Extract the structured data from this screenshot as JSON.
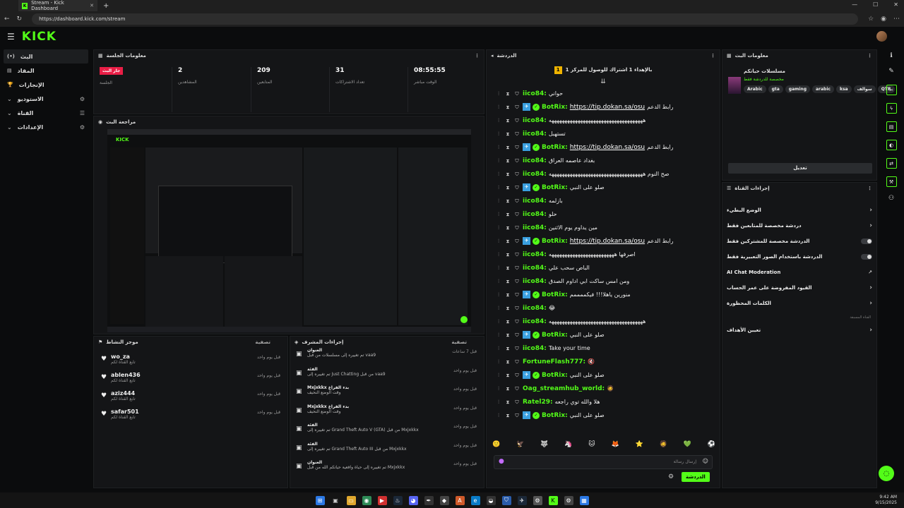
{
  "browser": {
    "tab_title": "Stream - Kick Dashboard",
    "url": "https://dashboard.kick.com/stream"
  },
  "app": {
    "logo": "KICK"
  },
  "sidebar": {
    "items": [
      {
        "label": "البث",
        "icon": "(•)"
      },
      {
        "label": "المقاد",
        "icon": "▤"
      },
      {
        "label": "الإنجازات",
        "icon": "🏆"
      },
      {
        "label": "الاستوديو",
        "icon": "⚙"
      },
      {
        "label": "القناة",
        "icon": "☰"
      },
      {
        "label": "الإعدادات",
        "icon": "⚙"
      }
    ]
  },
  "session": {
    "title": "معلومات الجلسة",
    "live_badge": "جار البث",
    "stats": [
      {
        "value": "",
        "label": "الجلسة"
      },
      {
        "value": "2",
        "label": "المشاهدين"
      },
      {
        "value": "209",
        "label": "المتابعين"
      },
      {
        "value": "31",
        "label": "تعداد الاشتراكات"
      },
      {
        "value": "08:55:55",
        "label": "الوقت مباشر"
      }
    ]
  },
  "preview": {
    "title": "مراجعة البث"
  },
  "activity": {
    "title": "موجز النشاط",
    "filter": "تصفية",
    "items": [
      {
        "name": "wo_za",
        "sub": "تابع القناة لكم",
        "time": "قبل يوم واحد"
      },
      {
        "name": "ablen436",
        "sub": "تابع القناة لكم",
        "time": "قبل يوم واحد"
      },
      {
        "name": "aziz444",
        "sub": "تابع القناة لكم",
        "time": "قبل يوم واحد"
      },
      {
        "name": "safar501",
        "sub": "تابع القناة لكم",
        "time": "قبل يوم واحد"
      }
    ]
  },
  "modlog": {
    "title": "إجراءات المشرف",
    "filter": "تصفية",
    "items": [
      {
        "head": "العنوان",
        "line": "تم تغييره إلى مسلسلات من قبل vaa9",
        "time": "قبل 7 ساعات"
      },
      {
        "head": "الفئة",
        "line": "تم تغييره إلى Just Chatting من قبل vaa9",
        "time": "قبل يوم واحد"
      },
      {
        "head": "Mxjxkkx بدء الفراغ",
        "line": "وقت الوضع النحيف",
        "time": "قبل يوم واحد"
      },
      {
        "head": "Mxjxkkx بدء الفراغ",
        "line": "وقت الوضع النحيف",
        "time": "قبل يوم واحد"
      },
      {
        "head": "الفئة",
        "line": "تم تغييره إلى Grand Theft Auto V (GTA) من قبل Mxjxkkx",
        "time": "قبل يوم واحد"
      },
      {
        "head": "الفئة",
        "line": "تم تغييره إلى Grand Theft Auto III من قبل Mxjxkkx",
        "time": "قبل يوم واحد"
      },
      {
        "head": "العنوان",
        "line": "تم تغييره إلى حياة واقعية حياتكم الله من قبل Mxjxkkx",
        "time": "قبل يوم واحد"
      }
    ]
  },
  "chat": {
    "title": "الدردشة",
    "pinned": "بالإهداء 1 اشتراك للوصول للمركز 1",
    "placeholder": "إرسال رسالة",
    "send": "الدردشة",
    "messages": [
      {
        "user": "iico84:",
        "text": "حواني",
        "link": "",
        "bot": false
      },
      {
        "user": "BotRix:",
        "text": "رابط الدعم",
        "link": "https://tip.dokan.sa/osu",
        "bot": true
      },
      {
        "user": "iico84:",
        "text": "ههههههههههههههههههههههههههههههههههههه",
        "link": "",
        "bot": false
      },
      {
        "user": "iico84:",
        "text": "تستهبل",
        "link": "",
        "bot": false
      },
      {
        "user": "BotRix:",
        "text": "رابط الدعم",
        "link": "https://tip.dokan.sa/osu",
        "bot": true
      },
      {
        "user": "iico84:",
        "text": "بغداد عاصمه العراق",
        "link": "",
        "bot": false
      },
      {
        "user": "iico84:",
        "text": "صح النوم ههههههههههههههههههههههههههههههههههههه",
        "link": "",
        "bot": false
      },
      {
        "user": "BotRix:",
        "text": "صلو على النبي",
        "link": "",
        "bot": true
      },
      {
        "user": "iico84:",
        "text": "بازلمه",
        "link": "",
        "bot": false
      },
      {
        "user": "iico84:",
        "text": "حلو",
        "link": "",
        "bot": false
      },
      {
        "user": "iico84:",
        "text": "مين يداوم يوم الاثنين",
        "link": "",
        "bot": false
      },
      {
        "user": "BotRix:",
        "text": "رابط الدعم",
        "link": "https://tip.dokan.sa/osu",
        "bot": true
      },
      {
        "user": "iico84:",
        "text": "اصرفها هههههههههههههههههههههههههه",
        "link": "",
        "bot": false
      },
      {
        "user": "iico84:",
        "text": "الباص سحب علي",
        "link": "",
        "bot": false
      },
      {
        "user": "iico84:",
        "text": "ومن امس ساكت ابي اداوم الصدق",
        "link": "",
        "bot": false
      },
      {
        "user": "BotRix:",
        "text": "منورين ياهلا!!! فيكممممم",
        "link": "",
        "bot": true
      },
      {
        "user": "iico84:",
        "text": "😂",
        "link": "",
        "bot": false
      },
      {
        "user": "iico84:",
        "text": "ههههههههههههههههههههههههههههههههههههه",
        "link": "",
        "bot": false
      },
      {
        "user": "BotRix:",
        "text": "صلو على النبي",
        "link": "",
        "bot": true
      },
      {
        "user": "iico84:",
        "text": "Take your time",
        "link": "",
        "bot": false
      },
      {
        "user": "FortuneFlash777:",
        "text": "🔇",
        "link": "",
        "bot": false
      },
      {
        "user": "BotRix:",
        "text": "صلو على النبي",
        "link": "",
        "bot": true
      },
      {
        "user": "Oag_streamhub_world:",
        "text": "🧔",
        "link": "",
        "bot": false
      },
      {
        "user": "Ratel29:",
        "text": "هلا والله توي راجعه",
        "link": "",
        "bot": false
      },
      {
        "user": "BotRix:",
        "text": "صلو على النبي",
        "link": "",
        "bot": true
      }
    ]
  },
  "streaminfo": {
    "title": "معلومات البث",
    "stream_title": "مسلسلات حياتكم",
    "category": "مخصصة للدردشة فقط",
    "tags": [
      "Arabic",
      "gta",
      "gaming",
      "arabic",
      "ksa",
      "سوالف",
      "QTR"
    ],
    "edit": "تعديل"
  },
  "channelactions": {
    "title": "إجراءات القناة",
    "items": [
      {
        "label": "الوضع البطيء",
        "control": "chevron"
      },
      {
        "label": "دردشة مخصصة للمتابعين فقط",
        "control": "chevron"
      },
      {
        "label": "الدردشة مخصصة للمشتركين فقط",
        "control": "toggle"
      },
      {
        "label": "الدردشة باستخدام الصور التعبيرية فقط",
        "control": "toggle"
      },
      {
        "label": "AI Chat Moderation",
        "control": "external"
      },
      {
        "label": "القيود المفروضة على عمر الحساب",
        "control": "chevron"
      },
      {
        "label": "الكلمات المحظورة",
        "control": "chevron"
      }
    ],
    "section_label": "القناة المسبقة",
    "goals": "تعيين الأهداف"
  },
  "tray": {
    "time": "9:42 AM",
    "date": "9/15/2025"
  },
  "colors": {
    "accent": "#53fc18",
    "live": "#e91e46",
    "bg": "#0b0c0d",
    "panel": "#141517"
  }
}
